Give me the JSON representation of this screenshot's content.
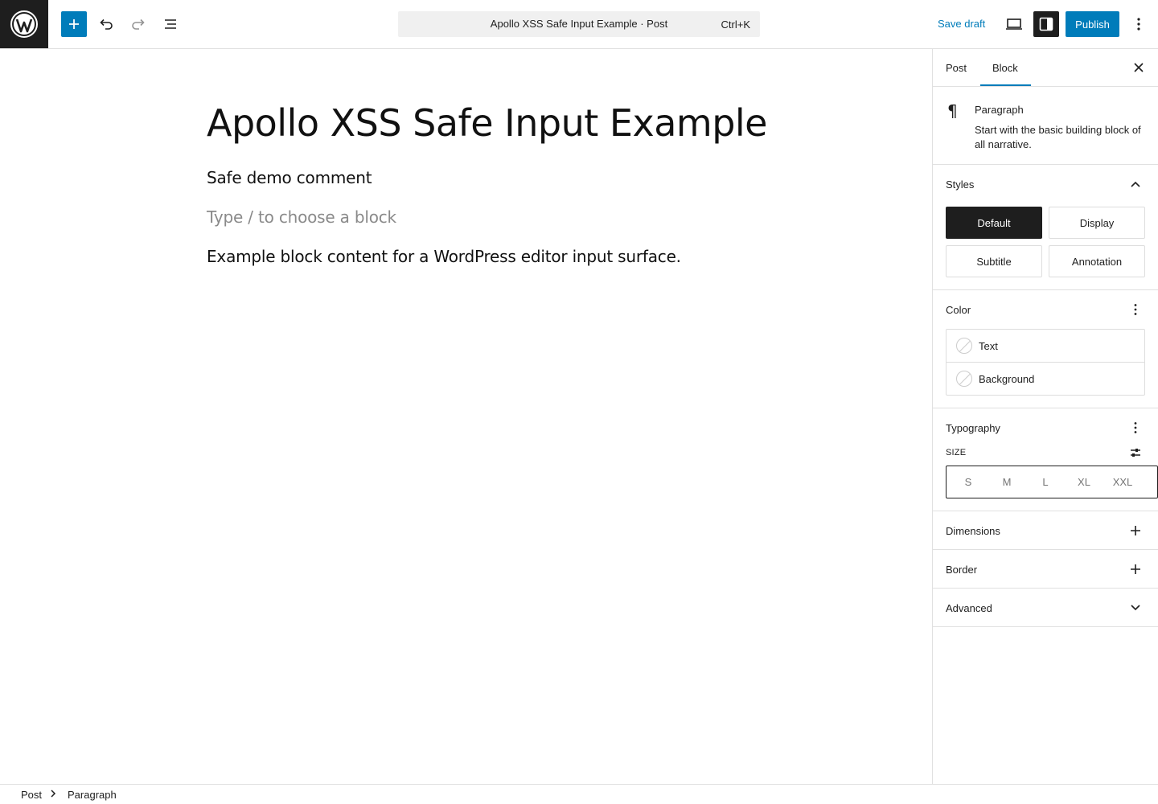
{
  "header": {
    "document_title": "Apollo XSS Safe Input Example · Post",
    "shortcut": "Ctrl+K",
    "save_draft": "Save draft",
    "publish": "Publish",
    "icons": [
      "wordpress-logo",
      "plus-icon",
      "undo-icon",
      "redo-icon",
      "document-overview-icon",
      "preview-icon",
      "settings-icon",
      "more-options-icon"
    ]
  },
  "editor": {
    "title": "Apollo XSS Safe Input Example",
    "blocks": [
      "Safe demo comment",
      "Type / to choose a block",
      "Example block content for a WordPress editor input surface."
    ]
  },
  "sidebar": {
    "tabs": [
      "Post",
      "Block"
    ],
    "active_tab": "Block",
    "block_card": {
      "icon": "¶",
      "title": "Paragraph",
      "description": "Start with the basic building block of all narrative."
    },
    "styles": {
      "title": "Styles",
      "options": [
        "Default",
        "Display",
        "Subtitle",
        "Annotation"
      ],
      "active": "Default"
    },
    "color": {
      "title": "Color",
      "items": [
        "Text",
        "Background"
      ]
    },
    "typography": {
      "title": "Typography",
      "size_label": "SIZE",
      "sizes": [
        "S",
        "M",
        "L",
        "XL",
        "XXL"
      ]
    },
    "dimensions": "Dimensions",
    "border": "Border",
    "advanced": "Advanced"
  },
  "breadcrumbs": [
    "Post",
    "Paragraph"
  ],
  "colors": {
    "accent": "#007cba",
    "dark": "#1e1e1e",
    "placeholder": "#8a8a8a"
  }
}
